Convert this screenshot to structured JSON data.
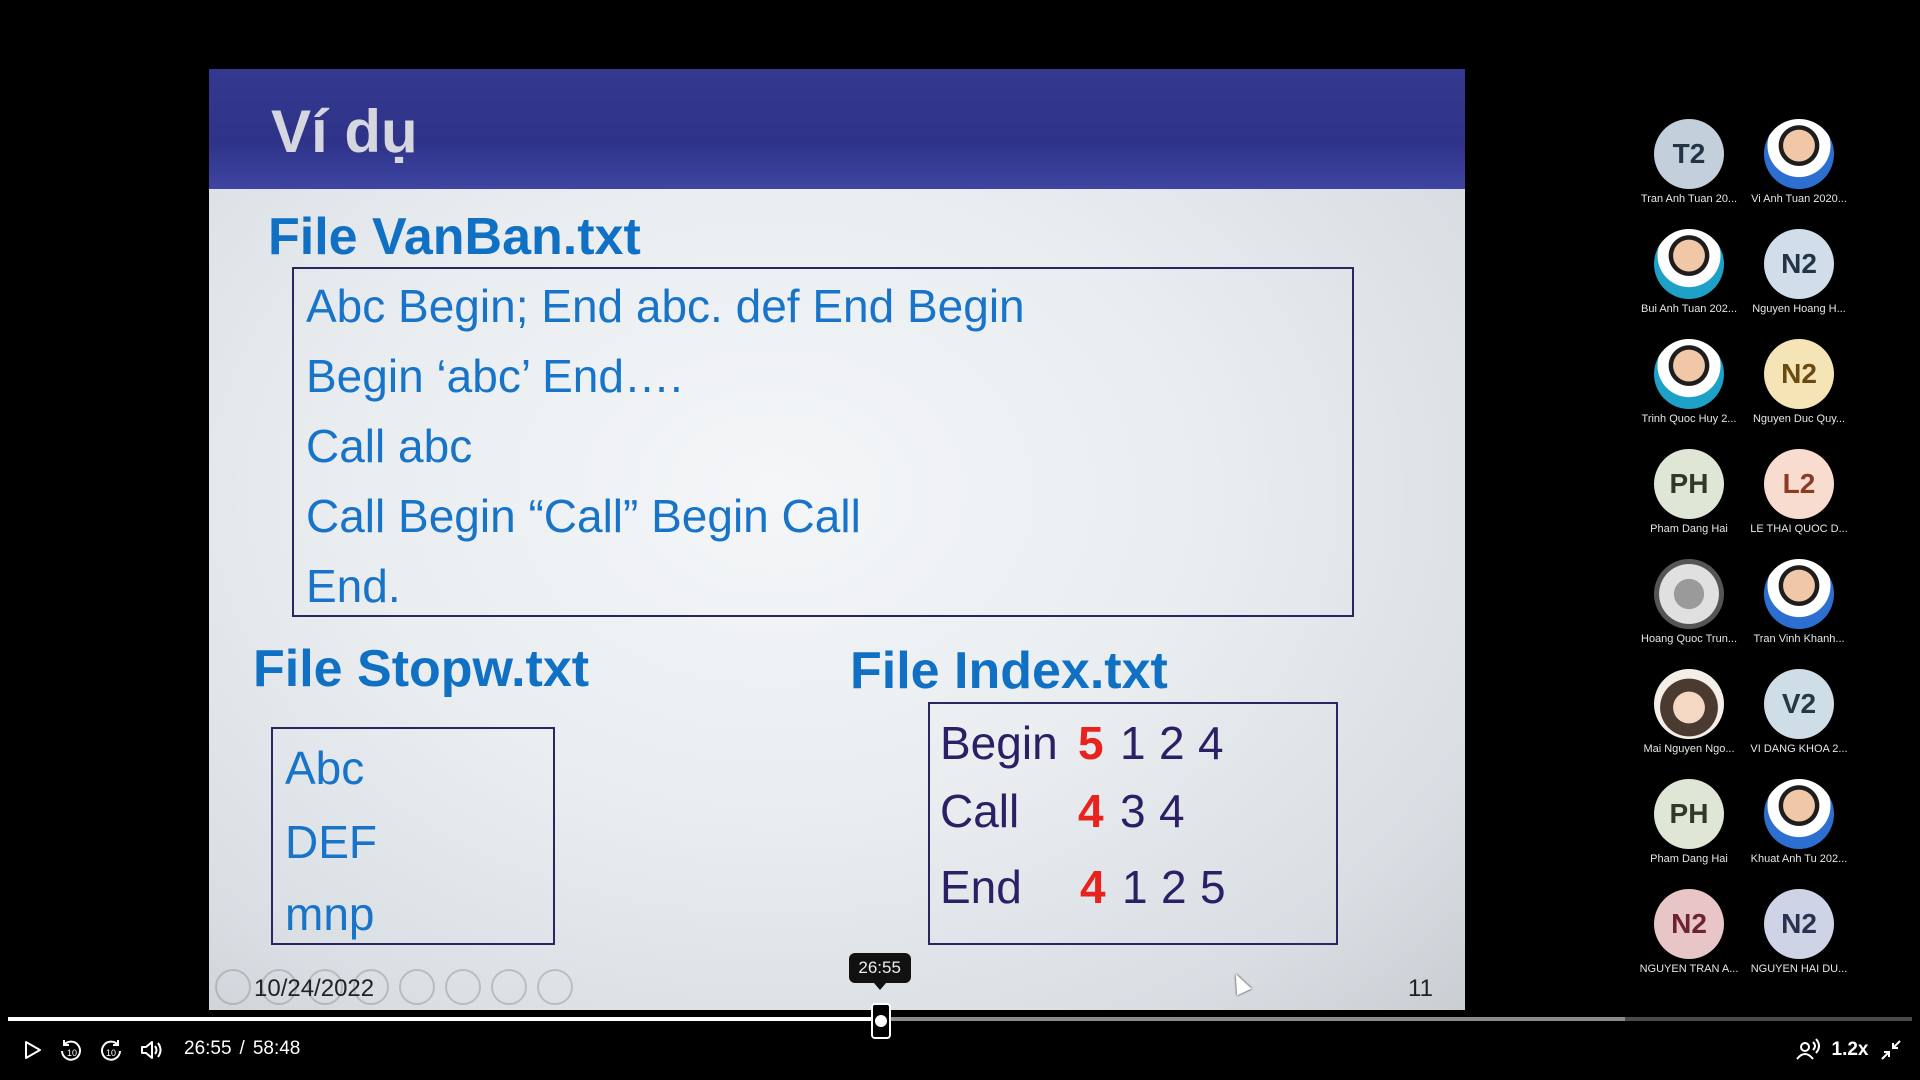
{
  "slide": {
    "title": "Ví dụ",
    "file1_heading": "File VanBan.txt",
    "file1_lines": [
      "Abc Begin;  End abc. def End Begin",
      "Begin ‘abc’ End….",
      "Call abc",
      "Call Begin “Call” Begin Call",
      "End."
    ],
    "file2_heading": "File Stopw.txt",
    "file2_lines": [
      "Abc",
      "DEF",
      "mnp"
    ],
    "file3_heading": "File Index.txt",
    "index_rows": [
      {
        "word": "Begin",
        "count": "5",
        "positions": [
          "1",
          "2",
          "4"
        ]
      },
      {
        "word": "Call",
        "count": "4",
        "positions": [
          "3",
          "4"
        ]
      },
      {
        "word": "End",
        "count": "4",
        "positions": [
          "1",
          "2",
          "5"
        ]
      }
    ],
    "date": "10/24/2022",
    "page_number": "11"
  },
  "participants": [
    {
      "initials": "T2",
      "name": "Tran Anh Tuan 20...",
      "color": "#c3cfdb",
      "text_color": "#243447"
    },
    {
      "initials": "",
      "name": "Vi Anh Tuan 2020...",
      "photo": "photo"
    },
    {
      "initials": "",
      "name": "Bui Anh Tuan 202...",
      "photo": "photo-teal"
    },
    {
      "initials": "N2",
      "name": "Nguyen Hoang H...",
      "color": "#d1dde8",
      "text_color": "#243447"
    },
    {
      "initials": "",
      "name": "Trinh Quoc Huy 2...",
      "photo": "photo-teal"
    },
    {
      "initials": "N2",
      "name": "Nguyen Duc Quy...",
      "color": "#f5e4b5",
      "text_color": "#6b4a12"
    },
    {
      "initials": "PH",
      "name": "Pham Dang Hai",
      "color": "#dfe6d6",
      "text_color": "#2f3a26"
    },
    {
      "initials": "L2",
      "name": "LE THAI QUOC D...",
      "color": "#f8dcd0",
      "text_color": "#8a3b22"
    },
    {
      "initials": "",
      "name": "Hoang Quoc Trun...",
      "photo": "photo-gray"
    },
    {
      "initials": "",
      "name": "Tran Vinh Khanh...",
      "photo": "photo"
    },
    {
      "initials": "",
      "name": "Mai Nguyen Ngo...",
      "photo": "photo-anime"
    },
    {
      "initials": "V2",
      "name": "VI DANG KHOA 2...",
      "color": "#cfdde6",
      "text_color": "#253846"
    },
    {
      "initials": "PH",
      "name": "Pham Dang Hai",
      "color": "#dfe6d6",
      "text_color": "#2f3a26"
    },
    {
      "initials": "",
      "name": "Khuat Anh Tu 202...",
      "photo": "photo"
    },
    {
      "initials": "N2",
      "name": "NGUYEN TRAN A...",
      "color": "#e8c6c8",
      "text_color": "#6e2330"
    },
    {
      "initials": "N2",
      "name": "NGUYEN HAI DU...",
      "color": "#cfd3e6",
      "text_color": "#2b3150"
    }
  ],
  "player": {
    "current_time": "26:55",
    "separator": "/",
    "duration": "58:48",
    "tooltip_time": "26:55",
    "progress_fraction": 0.4578,
    "buffered_fraction": 0.8495,
    "speed_label": "1.2x",
    "icons": {
      "play": "play-icon",
      "rewind": "rewind-10-icon",
      "forward": "forward-10-icon",
      "volume": "volume-icon",
      "captions": "live-captions-icon",
      "exit_fullscreen": "exit-fullscreen-icon"
    }
  }
}
